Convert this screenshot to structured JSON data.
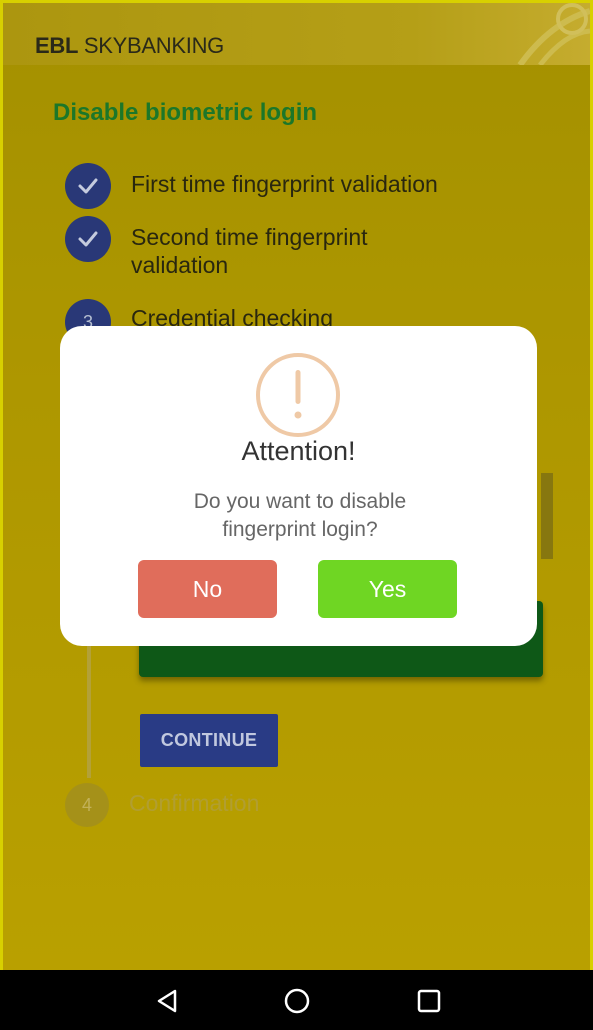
{
  "header": {
    "brand_bold": "EBL",
    "brand_rest": " SKYBANKING"
  },
  "page": {
    "title": "Disable biometric login"
  },
  "steps": [
    {
      "marker": "",
      "label": "First time fingerprint validation",
      "done": true
    },
    {
      "marker": "",
      "label": "Second time fingerprint validation",
      "done": true
    },
    {
      "marker": "3",
      "label": "Credential checking",
      "done": false
    },
    {
      "marker": "4",
      "label": "Confirmation",
      "done": false
    }
  ],
  "continue_label": "CONTINUE",
  "dialog": {
    "icon": "exclamation-circle-icon",
    "title": "Attention!",
    "message": "Do you want to disable fingerprint login?",
    "no_label": "No",
    "yes_label": "Yes"
  },
  "navbar": {
    "icons": [
      "back-triangle-icon",
      "home-circle-icon",
      "recents-square-icon"
    ]
  },
  "colors": {
    "background": "#b29b00",
    "title_green": "#1d7a2a",
    "step_blue": "#2a3a7a",
    "no_button": "#e06d5b",
    "yes_button": "#6fd623"
  }
}
